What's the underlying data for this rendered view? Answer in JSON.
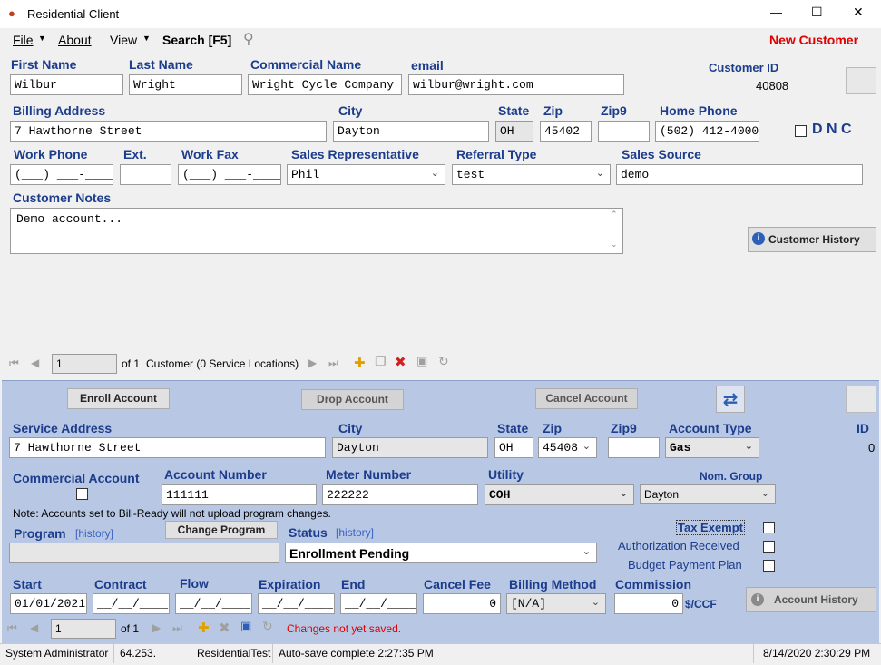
{
  "window": {
    "title": "Residential Client",
    "minimize": "—",
    "maximize": "☐",
    "close": "✕"
  },
  "menu": {
    "file": "File",
    "about": "About",
    "view": "View",
    "search": "Search [F5]",
    "new_customer": "New Customer"
  },
  "customer": {
    "first_name_label": "First Name",
    "first_name": "Wilbur",
    "last_name_label": "Last Name",
    "last_name": "Wright",
    "commercial_name_label": "Commercial Name",
    "commercial_name": "Wright Cycle Company",
    "email_label": "email",
    "email": "wilbur@wright.com",
    "customer_id_label": "Customer ID",
    "customer_id": "40808",
    "billing_address_label": "Billing Address",
    "billing_address": "7 Hawthorne Street",
    "city_label": "City",
    "city": "Dayton",
    "state_label": "State",
    "state": "OH",
    "zip_label": "Zip",
    "zip": "45402",
    "zip9_label": "Zip9",
    "zip9": "",
    "home_phone_label": "Home Phone",
    "home_phone": "(502) 412-4000",
    "dnc_label": "D N C",
    "work_phone_label": "Work Phone",
    "work_phone": "(___) ___-____",
    "ext_label": "Ext.",
    "ext": "",
    "work_fax_label": "Work Fax",
    "work_fax": "(___) ___-____",
    "sales_rep_label": "Sales Representative",
    "sales_rep": "Phil",
    "referral_type_label": "Referral Type",
    "referral_type": "test",
    "sales_source_label": "Sales Source",
    "sales_source": "demo",
    "notes_label": "Customer Notes",
    "notes": "Demo account...",
    "history_button": "Customer History"
  },
  "customer_nav": {
    "position": "1",
    "of": "of 1",
    "status": "Customer (0 Service Locations)"
  },
  "account": {
    "enroll_button": "Enroll Account",
    "drop_button": "Drop Account",
    "cancel_button": "Cancel Account",
    "service_address_label": "Service Address",
    "service_address": "7 Hawthorne Street",
    "city_label": "City",
    "city": "Dayton",
    "state_label": "State",
    "state": "OH",
    "zip_label": "Zip",
    "zip": "45408",
    "zip9_label": "Zip9",
    "zip9": "",
    "account_type_label": "Account Type",
    "account_type": "Gas",
    "id_label": "ID",
    "id": "0",
    "commercial_account_label": "Commercial Account",
    "account_number_label": "Account Number",
    "account_number": "111111",
    "meter_number_label": "Meter Number",
    "meter_number": "222222",
    "utility_label": "Utility",
    "utility": "COH",
    "nom_group_label": "Nom. Group",
    "nom_group": "Dayton",
    "note": "Note: Accounts set to Bill-Ready will not upload program changes.",
    "program_label": "Program",
    "program_history": "[history]",
    "program": "",
    "change_program_button": "Change Program",
    "status_label": "Status",
    "status_history": "[history]",
    "status": "Enrollment Pending",
    "tax_exempt_label": "Tax Exempt",
    "authorization_label": "Authorization Received",
    "budget_label": "Budget Payment Plan",
    "start_label": "Start",
    "start": "01/01/2021",
    "contract_label": "Contract",
    "contract": "__/__/____",
    "flow_label": "Flow",
    "flow": "__/__/____",
    "expiration_label": "Expiration",
    "expiration": "__/__/____",
    "end_label": "End",
    "end": "__/__/____",
    "cancel_fee_label": "Cancel Fee",
    "cancel_fee": "0",
    "billing_method_label": "Billing Method",
    "billing_method": "[N/A]",
    "commission_label": "Commission",
    "commission": "0",
    "commission_unit": "$/CCF",
    "history_button": "Account History"
  },
  "account_nav": {
    "position": "1",
    "of": "of 1",
    "status": "Changes not yet saved."
  },
  "statusbar": {
    "user": "System Administrator",
    "ip": "64.253.",
    "db": "ResidentialTest",
    "autosave": "Auto-save complete 2:27:35 PM",
    "datetime": "8/14/2020 2:30:29 PM"
  },
  "colors": {
    "label": "#1c3c8c",
    "new_customer": "#e00000",
    "lower_panel": "#b8c8e4",
    "warning": "#e00000"
  }
}
